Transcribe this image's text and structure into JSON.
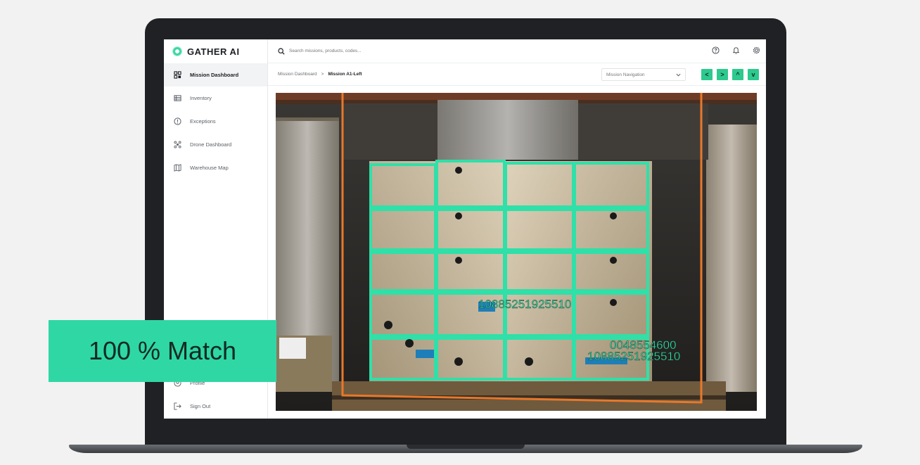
{
  "app": {
    "logo_text": "GATHER AI",
    "accent_color": "#2fd7a4"
  },
  "sidebar": {
    "items": [
      {
        "label": "Mission Dashboard",
        "icon": "grid-icon",
        "active": true
      },
      {
        "label": "Inventory",
        "icon": "list-icon"
      },
      {
        "label": "Exceptions",
        "icon": "alert-circle-icon"
      },
      {
        "label": "Drone Dashboard",
        "icon": "drone-icon"
      },
      {
        "label": "Warehouse Map",
        "icon": "map-icon"
      }
    ],
    "bottom_items": [
      {
        "label": "Profile",
        "icon": "profile-icon"
      },
      {
        "label": "Sign Out",
        "icon": "sign-out-icon"
      }
    ]
  },
  "header": {
    "search_placeholder": "Search missions, products, codes...",
    "icons": [
      "help-icon",
      "bell-icon",
      "settings-icon"
    ]
  },
  "breadcrumb": {
    "parent": "Mission Dashboard",
    "separator": ">",
    "current": "Mission A1-Left"
  },
  "mission_navigation": {
    "label": "Mission Navigation",
    "buttons": [
      "<",
      ">",
      "^",
      "v"
    ]
  },
  "detections": {
    "label_1": "10885251925510",
    "label_2": "0048554600",
    "label_3": "10885251925510"
  },
  "badge": {
    "text": "100 % Match"
  }
}
